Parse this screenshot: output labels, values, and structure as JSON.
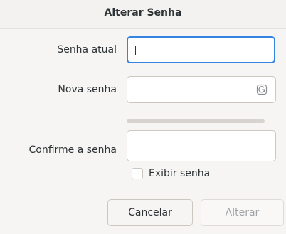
{
  "dialog": {
    "title": "Alterar Senha"
  },
  "form": {
    "current_password_label": "Senha atual",
    "current_password_value": "",
    "new_password_label": "Nova senha",
    "new_password_value": "",
    "new_password_peek_icon": "password-generate-icon",
    "strength_level": 0,
    "confirm_password_label": "Confirme a senha",
    "confirm_password_value": "",
    "show_password_label": "Exibir senha",
    "show_password_checked": false
  },
  "buttons": {
    "cancel_label": "Cancelar",
    "change_label": "Alterar",
    "change_enabled": false
  },
  "colors": {
    "accent": "#3584e4",
    "background": "#f6f5f4",
    "text": "#2e3436",
    "disabled_text": "#a0a4a6"
  }
}
